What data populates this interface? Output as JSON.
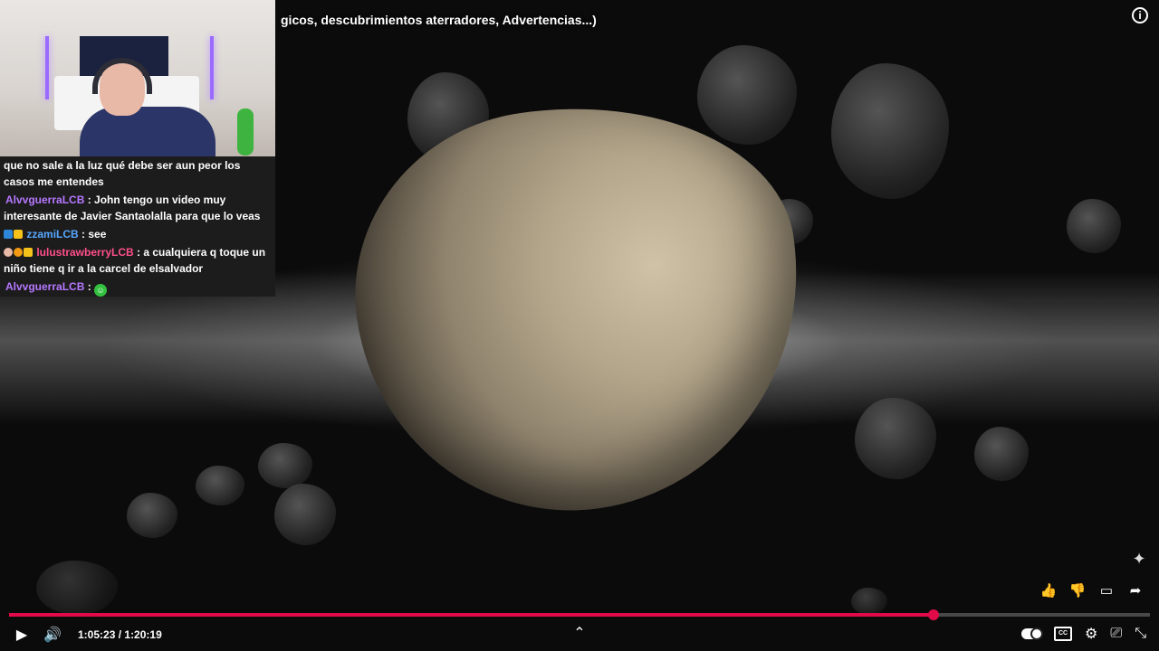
{
  "video": {
    "title": "gicos, descubrimientos aterradores, Advertencias...)",
    "current_time": "1:05:23",
    "duration": "1:20:19",
    "time_separator": " / ",
    "progress_fraction": 0.81
  },
  "chat": {
    "messages": [
      {
        "user": "",
        "text": "que no sale a la luz qué debe ser aun peor los casos me entendes",
        "user_color": "#ffffff"
      },
      {
        "user": "AlvvguerraLCB",
        "text": " : John tengo un video muy interesante de Javier Santaolalla para que lo veas",
        "user_color": "#b678ff"
      },
      {
        "user": "zzamiLCB",
        "text": " : see",
        "user_color": "#57a6ff"
      },
      {
        "user": "lulustrawberryLCB",
        "text": " : a cualquiera q toque un niño tiene q ir a la carcel de elsalvador",
        "user_color": "#ff4f8b"
      },
      {
        "user": "AlvvguerraLCB",
        "text": " : ",
        "user_color": "#b678ff"
      }
    ]
  },
  "controls": {
    "play_icon": "play-icon",
    "volume_icon": "volume-icon",
    "chevron_icon": "chevron-up-icon",
    "autoplay_icon": "autoplay-toggle-icon",
    "subtitles_icon": "subtitles-icon",
    "settings_icon": "settings-icon",
    "cast_icon": "cast-icon",
    "exit_fullscreen_icon": "exit-fullscreen-icon"
  },
  "side_actions": [
    "like-icon",
    "dislike-icon",
    "comment-icon",
    "share-icon"
  ],
  "colors": {
    "progress": "#e10b4a",
    "accent_red": "#ff0033"
  }
}
